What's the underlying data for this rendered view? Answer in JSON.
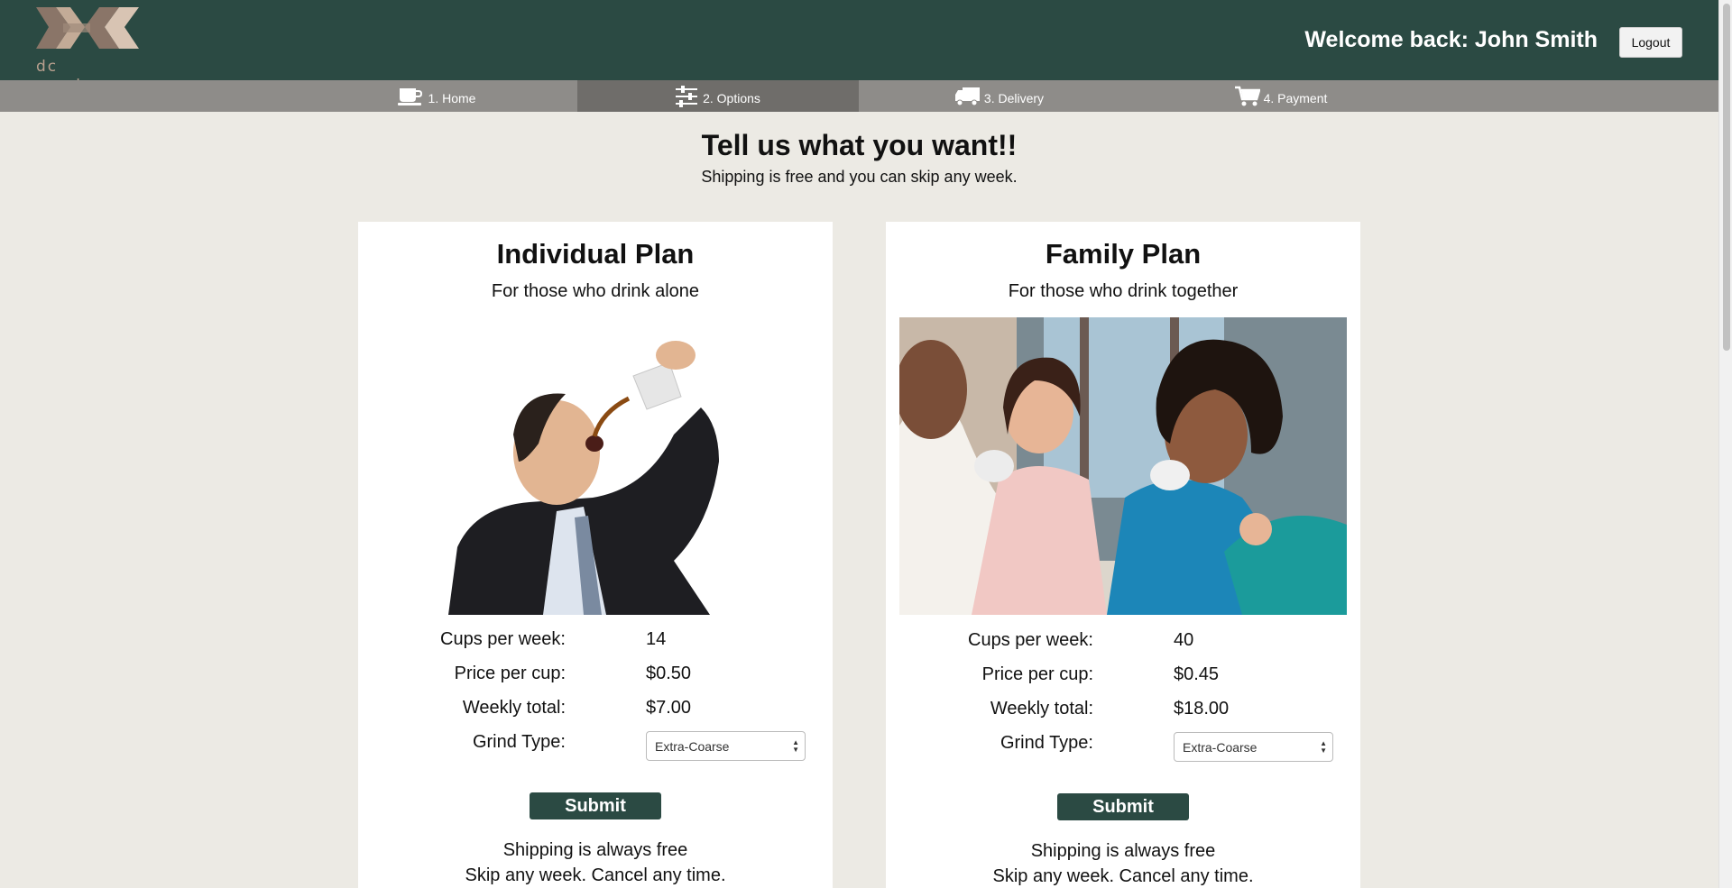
{
  "header": {
    "logo_text": "dc roasters",
    "welcome": "Welcome back: John Smith",
    "logout_label": "Logout"
  },
  "nav": {
    "items": [
      {
        "label": "1. Home",
        "icon": "coffee-cup-icon"
      },
      {
        "label": "2. Options",
        "icon": "sliders-icon"
      },
      {
        "label": "3. Delivery",
        "icon": "truck-icon"
      },
      {
        "label": "4. Payment",
        "icon": "cart-icon"
      }
    ],
    "active_index": 1
  },
  "intro": {
    "title": "Tell us what you want!!",
    "subtitle": "Shipping is free and you can skip any week."
  },
  "plans": [
    {
      "title": "Individual Plan",
      "subtitle": "For those who drink alone",
      "cups_label": "Cups per week:",
      "cups_value": "14",
      "price_label": "Price per cup:",
      "price_value": "$0.50",
      "total_label": "Weekly total:",
      "total_value": "$7.00",
      "grind_label": "Grind Type:",
      "grind_value": "Extra-Coarse",
      "submit_label": "Submit",
      "footer_1": "Shipping is always free",
      "footer_2": "Skip any week. Cancel any time."
    },
    {
      "title": "Family Plan",
      "subtitle": "For those who drink together",
      "cups_label": "Cups per week:",
      "cups_value": "40",
      "price_label": "Price per cup:",
      "price_value": "$0.45",
      "total_label": "Weekly total:",
      "total_value": "$18.00",
      "grind_label": "Grind Type:",
      "grind_value": "Extra-Coarse",
      "submit_label": "Submit",
      "footer_1": "Shipping is always free",
      "footer_2": "Skip any week. Cancel any time."
    }
  ],
  "colors": {
    "header_bg": "#2b4a43",
    "nav_bg": "#8e8c89",
    "nav_active": "#6f6d6a",
    "page_bg": "#eceae4",
    "button_bg": "#2b4a43"
  }
}
